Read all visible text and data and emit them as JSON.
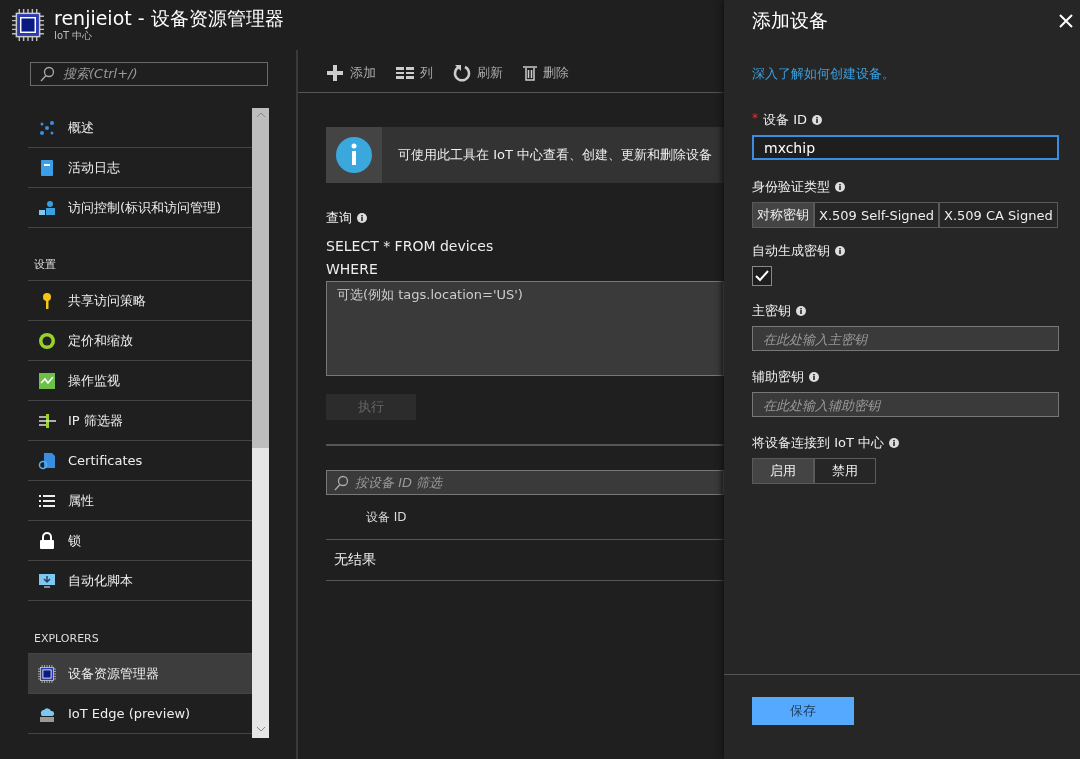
{
  "header": {
    "title": "renjieiot - 设备资源管理器",
    "subtitle": "IoT 中心"
  },
  "sidebar": {
    "search": {
      "placeholder": "搜索(Ctrl+/)"
    },
    "items": [
      {
        "kind": "item",
        "label": "概述",
        "selected": false
      },
      {
        "kind": "item",
        "label": "活动日志",
        "selected": false
      },
      {
        "kind": "item",
        "label": "访问控制(标识和访问管理)",
        "selected": false
      },
      {
        "kind": "header",
        "label": "设置"
      },
      {
        "kind": "item",
        "label": "共享访问策略",
        "selected": false
      },
      {
        "kind": "item",
        "label": "定价和缩放",
        "selected": false
      },
      {
        "kind": "item",
        "label": "操作监视",
        "selected": false
      },
      {
        "kind": "item",
        "label": "IP 筛选器",
        "selected": false
      },
      {
        "kind": "item",
        "label": "Certificates",
        "selected": false
      },
      {
        "kind": "item",
        "label": "属性",
        "selected": false
      },
      {
        "kind": "item",
        "label": "锁",
        "selected": false
      },
      {
        "kind": "item",
        "label": "自动化脚本",
        "selected": false
      },
      {
        "kind": "header",
        "label": "EXPLORERS"
      },
      {
        "kind": "item",
        "label": "设备资源管理器",
        "selected": true
      },
      {
        "kind": "item",
        "label": "IoT Edge (preview)",
        "selected": false
      }
    ]
  },
  "toolbar": [
    {
      "label": "添加"
    },
    {
      "label": "列"
    },
    {
      "label": "刷新"
    },
    {
      "label": "删除"
    }
  ],
  "info_banner": "可使用此工具在 IoT 中心查看、创建、更新和删除设备",
  "query": {
    "label": "查询",
    "select_line": "SELECT * FROM devices",
    "where_line": "WHERE",
    "placeholder": "可选(例如 tags.location='US')",
    "run_button": {
      "label": "执行",
      "disabled": true
    }
  },
  "filter": {
    "placeholder": "按设备 ID 筛选"
  },
  "table": {
    "columns": [
      "设备 ID"
    ],
    "empty_text": "无结果"
  },
  "panel": {
    "title": "添加设备",
    "link": "深入了解如何创建设备。",
    "device_id": {
      "label": "设备 ID",
      "required_mark": "*",
      "value": "mxchip"
    },
    "auth_type": {
      "label": "身份验证类型",
      "options": [
        {
          "label": "对称密钥",
          "selected": true
        },
        {
          "label": "X.509 Self-Signed",
          "selected": false
        },
        {
          "label": "X.509 CA Signed",
          "selected": false
        }
      ]
    },
    "auto_keys": {
      "label": "自动生成密钥",
      "checked": true
    },
    "primary_key": {
      "label": "主密钥",
      "placeholder": "在此处输入主密钥"
    },
    "secondary_key": {
      "label": "辅助密钥",
      "placeholder": "在此处输入辅助密钥"
    },
    "connect": {
      "label": "将设备连接到 IoT 中心",
      "options": [
        {
          "label": "启用",
          "selected": true
        },
        {
          "label": "禁用",
          "selected": false
        }
      ]
    },
    "save_button": "保存"
  }
}
